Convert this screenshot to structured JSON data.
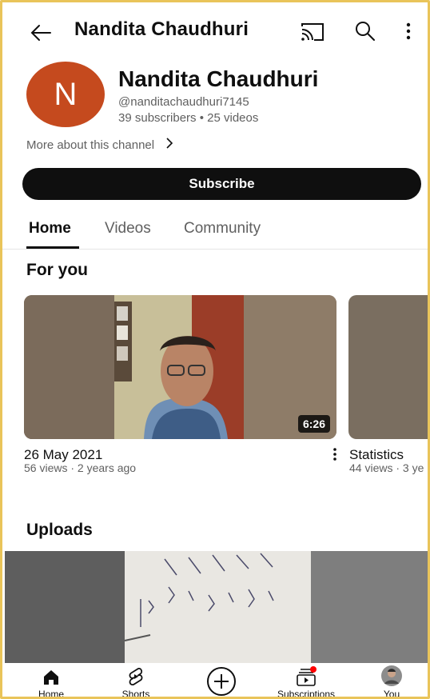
{
  "header": {
    "title": "Nandita Chaudhuri"
  },
  "channel": {
    "avatar_letter": "N",
    "avatar_color": "#c54a1e",
    "name": "Nandita Chaudhuri",
    "handle": "@nanditachaudhuri7145",
    "subscribers": "39 subscribers",
    "separator": "•",
    "videos": "25 videos",
    "more_about": "More about this channel",
    "subscribe_label": "Subscribe"
  },
  "tabs": [
    {
      "label": "Home",
      "active": true
    },
    {
      "label": "Videos",
      "active": false
    },
    {
      "label": "Community",
      "active": false
    }
  ],
  "sections": {
    "for_you": "For you",
    "uploads": "Uploads"
  },
  "videos": [
    {
      "title": "26 May 2021",
      "meta": "56 views · 2 years ago",
      "duration": "6:26"
    },
    {
      "title": "Statistics",
      "meta": "44 views · 3 ye"
    }
  ],
  "bottom_nav": [
    {
      "label": "Home",
      "icon": "home-icon"
    },
    {
      "label": "Shorts",
      "icon": "shorts-icon"
    },
    {
      "label": "",
      "icon": "create-icon"
    },
    {
      "label": "Subscriptions",
      "icon": "subscriptions-icon"
    },
    {
      "label": "You",
      "icon": "profile-avatar"
    }
  ],
  "colors": {
    "text_primary": "#0f0f0f",
    "text_secondary": "#606060",
    "notification_dot": "#ff0000",
    "frame_border": "#e9c45a"
  }
}
